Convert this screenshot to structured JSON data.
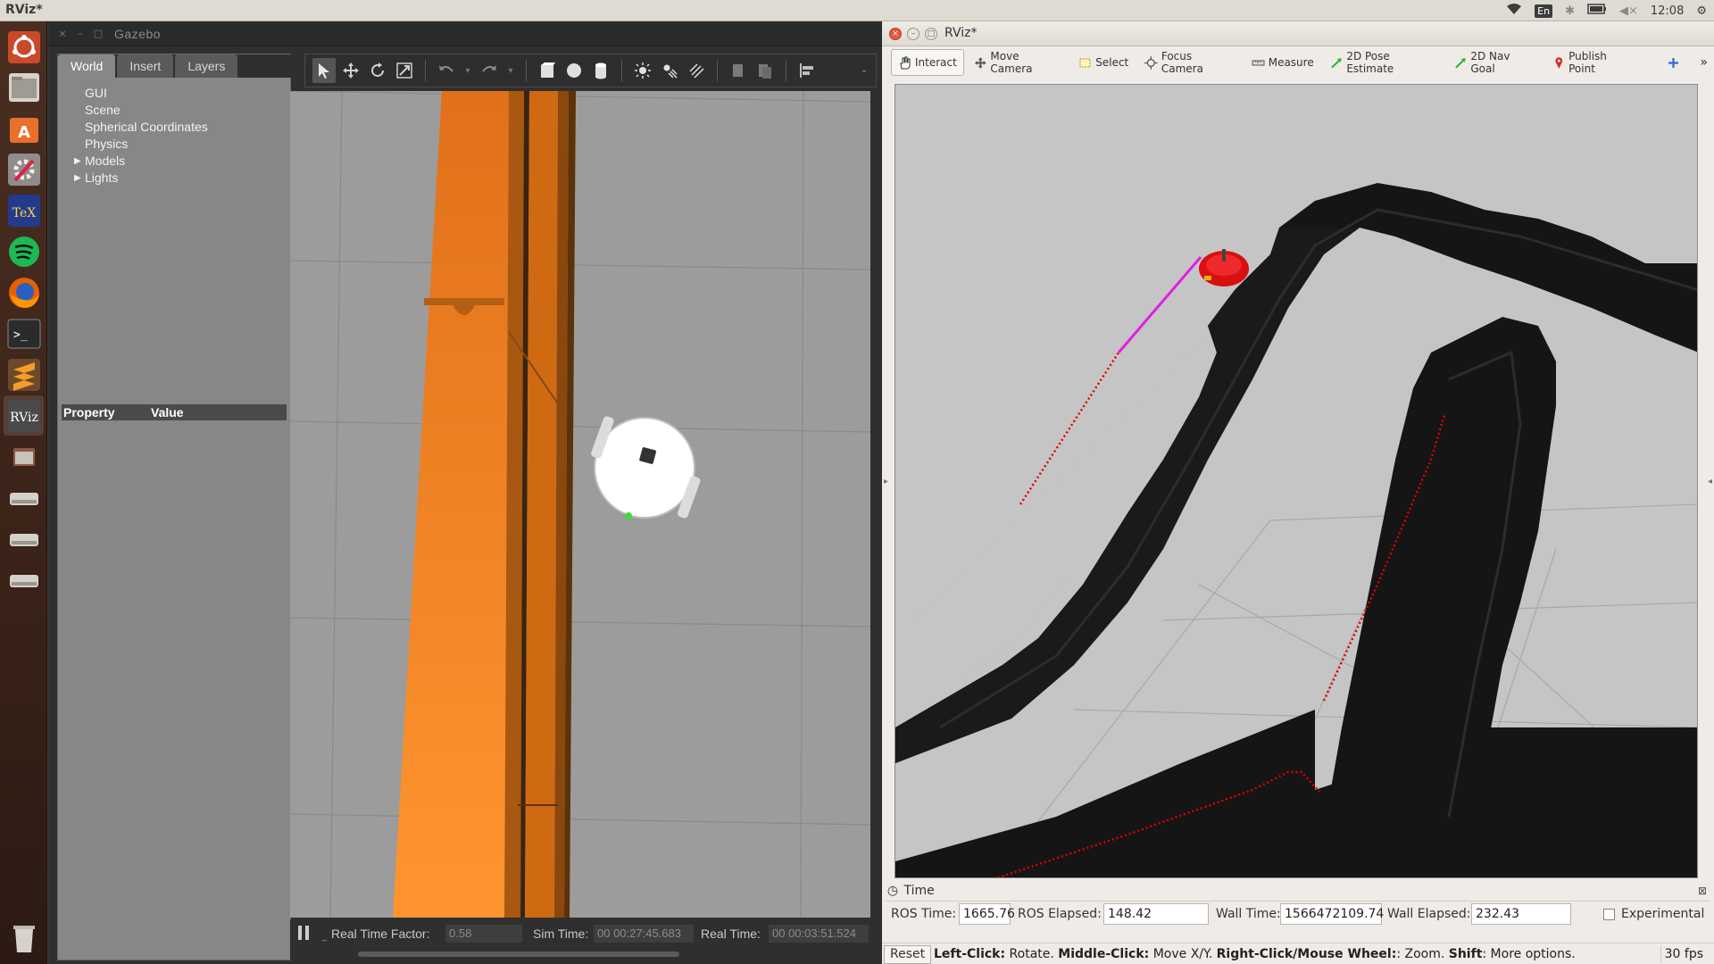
{
  "top_panel": {
    "active_app": "RViz*",
    "keyboard_lang": "En",
    "clock": "12:08"
  },
  "launcher": {
    "items": [
      "ubuntu-dash",
      "files",
      "software-center",
      "system-settings",
      "texmaker",
      "spotify",
      "firefox",
      "terminal",
      "sublime",
      "rviz",
      "window",
      "drive-1",
      "drive-2",
      "drive-3",
      "trash"
    ]
  },
  "gazebo": {
    "title": "Gazebo",
    "tabs": [
      "World",
      "Insert",
      "Layers"
    ],
    "tree": [
      "GUI",
      "Scene",
      "Spherical Coordinates",
      "Physics",
      "Models",
      "Lights"
    ],
    "prop_headers": {
      "property": "Property",
      "value": "Value"
    },
    "bottom": {
      "rtf_label": "Real Time Factor:",
      "rtf_value": "0.58",
      "sim_time_label": "Sim Time:",
      "sim_time_value": "00 00:27:45.683",
      "real_time_label": "Real Time:",
      "real_time_value": "00 00:03:51.524"
    }
  },
  "rviz": {
    "title": "RViz*",
    "tools": [
      {
        "label": "Interact",
        "icon": "hand-icon"
      },
      {
        "label": "Move Camera",
        "icon": "move-camera-icon"
      },
      {
        "label": "Select",
        "icon": "select-icon"
      },
      {
        "label": "Focus Camera",
        "icon": "focus-icon"
      },
      {
        "label": "Measure",
        "icon": "ruler-icon"
      },
      {
        "label": "2D Pose Estimate",
        "icon": "pose-arrow-icon"
      },
      {
        "label": "2D Nav Goal",
        "icon": "nav-arrow-icon"
      },
      {
        "label": "Publish Point",
        "icon": "pin-icon"
      }
    ],
    "time_panel": {
      "title": "Time",
      "ros_time_label": "ROS Time:",
      "ros_time": "1665.76",
      "ros_elapsed_label": "ROS Elapsed:",
      "ros_elapsed": "148.42",
      "wall_time_label": "Wall Time:",
      "wall_time": "1566472109.74",
      "wall_elapsed_label": "Wall Elapsed:",
      "wall_elapsed": "232.43",
      "experimental_label": "Experimental"
    },
    "status": {
      "reset": "Reset",
      "lc": "Left-Click:",
      "lc_text": " Rotate. ",
      "mc": "Middle-Click:",
      "mc_text": " Move X/Y. ",
      "rc": "Right-Click/Mouse Wheel:",
      "rc_text": ": Zoom. ",
      "sh": "Shift",
      "sh_text": ": More options.",
      "fps": "30 fps"
    }
  }
}
